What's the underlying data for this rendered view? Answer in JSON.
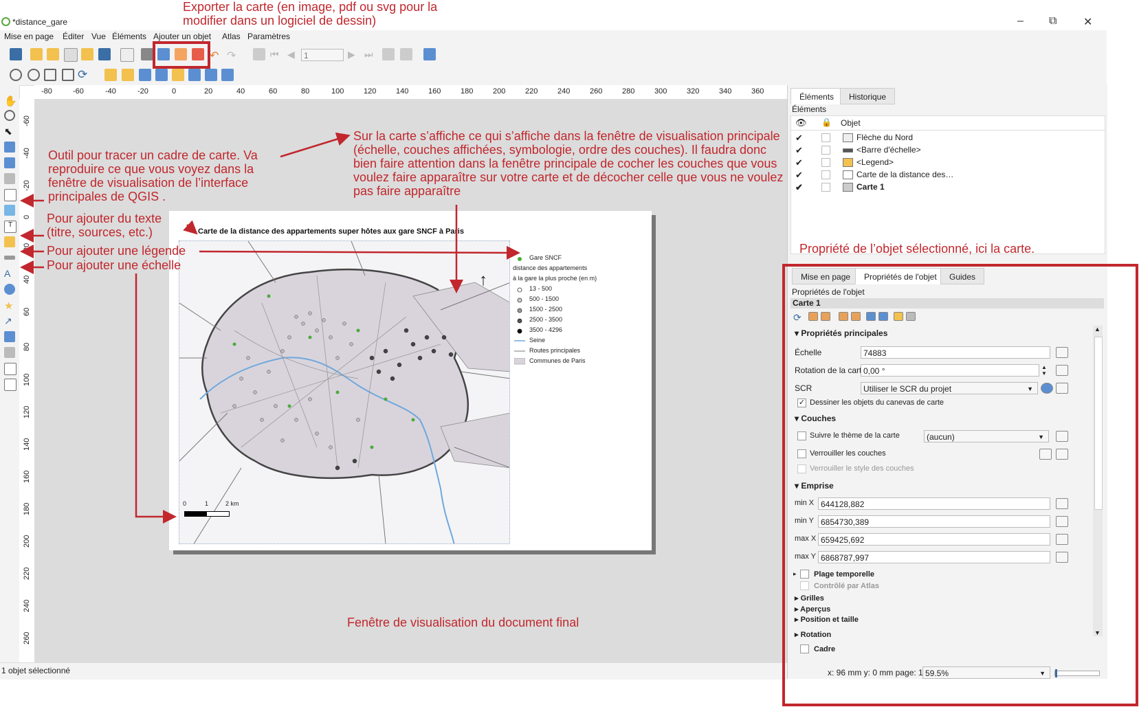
{
  "window": {
    "title": "*distance_gare",
    "minimize": "–",
    "maximize": "⧉",
    "close": "✕"
  },
  "menu": [
    "Mise en page",
    "Éditer",
    "Vue",
    "Éléments",
    "Ajouter un objet",
    "Atlas",
    "Paramètres"
  ],
  "toolbar": {
    "page_number": "1"
  },
  "ruler": {
    "h_ticks": [
      "-80",
      "-60",
      "-40",
      "-20",
      "0",
      "20",
      "40",
      "60",
      "80",
      "100",
      "120",
      "140",
      "160",
      "180",
      "200",
      "220",
      "240",
      "260",
      "280",
      "300",
      "320",
      "340",
      "360"
    ],
    "v_ticks": [
      "-60",
      "-40",
      "-20",
      "0",
      "20",
      "40",
      "60",
      "80",
      "100",
      "120",
      "140",
      "160",
      "180",
      "200",
      "220",
      "240",
      "260"
    ]
  },
  "layout": {
    "map_title": "Carte de la distance des appartements super hôtes aux gare SNCF à Paris",
    "north_arrow": "↑",
    "legend": {
      "station": "Gare SNCF",
      "heading_1": "distance des appartements",
      "heading_2": "à la gare la plus proche (en m)",
      "classes": [
        "13 - 500",
        "500 - 1500",
        "1500 - 2500",
        "2500 - 3500",
        "3500 - 4296"
      ],
      "river": "Seine",
      "roads": "Routes principales",
      "communes": "Communes de Paris"
    },
    "scale": {
      "t0": "0",
      "t1": "1",
      "t2": "2 km"
    }
  },
  "status": {
    "selected": "1 objet sélectionné",
    "coords": "x: 96 mm y: 0 mm page: 1",
    "zoom": "59.5%"
  },
  "panel": {
    "tabs_top": [
      "Éléments",
      "Historique"
    ],
    "elements_heading": "Éléments",
    "column_object": "Objet",
    "items": [
      {
        "label": "Flèche du Nord",
        "checked": "✔"
      },
      {
        "label": "<Barre d'échelle>",
        "checked": "✔"
      },
      {
        "label": "<Legend>",
        "checked": "✔"
      },
      {
        "label": "Carte de la distance des…",
        "checked": "✔"
      },
      {
        "label": "Carte 1",
        "checked": "✔"
      }
    ],
    "tabs_bottom": [
      "Mise en page",
      "Propriétés de l'objet",
      "Guides"
    ],
    "props_heading": "Propriétés de l'objet",
    "object_name": "Carte 1",
    "main_section": "Propriétés principales",
    "scale_label": "Échelle",
    "scale_value": "74883",
    "rotation_label": "Rotation de la carte",
    "rotation_value": "0,00 °",
    "crs_label": "SCR",
    "crs_value": "Utiliser le SCR du projet",
    "draw_canvas_items": "Dessiner les objets du canevas de carte",
    "layers_section": "Couches",
    "follow_theme": "Suivre le thème de la carte",
    "theme_value": "(aucun)",
    "lock_layers": "Verrouiller les couches",
    "lock_styles": "Verrouiller le style des couches",
    "extent_section": "Emprise",
    "min_x_label": "min X",
    "min_x": "644128,882",
    "min_y_label": "min Y",
    "min_y": "6854730,389",
    "max_x_label": "max X",
    "max_x": "659425,692",
    "max_y_label": "max Y",
    "max_y": "6868787,997",
    "temporal": "Plage temporelle",
    "atlas_ctrl": "Contrôlé par Atlas",
    "grids": "Grilles",
    "overviews": "Aperçus",
    "position_size": "Position et taille",
    "rotation": "Rotation",
    "frame": "Cadre"
  },
  "annotations": {
    "export": "Exporter la carte (en image, pdf ou svg pour la modifier dans un logiciel de dessin)",
    "frame_tool": "Outil pour tracer un cadre de carte. Va reproduire ce que vous voyez dans la fenêtre de visualisation de l’interface principales de QGIS .",
    "text_tool": "Pour ajouter du texte (titre, sources, etc.)",
    "legend_tool": "Pour ajouter une légende",
    "scale_tool": "Pour ajouter une échelle",
    "map_note": "Sur la carte s’affiche ce qui s’affiche dans la fenêtre de visualisation principale (échelle, couches affichées, symbologie, ordre des couches). Il faudra donc bien faire attention dans la fenêtre principale de cocher les couches que vous voulez faire apparaître sur votre carte et de décocher celle que vous ne voulez pas faire apparaître",
    "props_note": "Propriété de l’objet sélectionné, ici la carte.",
    "viewer_note": "Fenêtre de visualisation du document final"
  },
  "colors": {
    "annotation_red": "#c1272d",
    "station_green": "#4caa3c",
    "seine_blue": "#6fa8dc",
    "commune_fill": "#d9d4dc"
  }
}
